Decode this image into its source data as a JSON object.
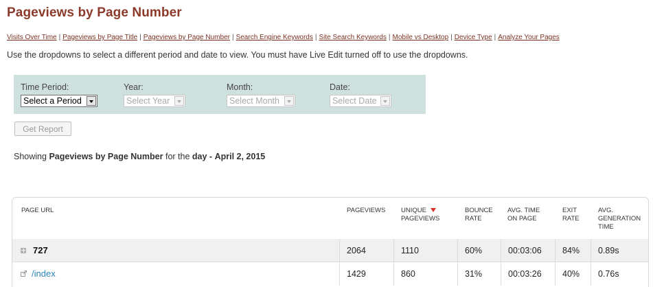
{
  "page": {
    "title": "Pageviews by Page Number",
    "instructions": "Use the dropdowns to select a different period and date to view. You must have Live Edit turned off to use the dropdowns."
  },
  "nav": {
    "links": [
      "Visits Over Time",
      "Pageviews by Page Title",
      "Pageviews by Page Number",
      "Search Engine Keywords",
      "Site Search Keywords",
      "Mobile vs Desktop",
      "Device Type",
      "Analyze Your Pages"
    ],
    "separator": "|"
  },
  "filters": {
    "time_period": {
      "label": "Time Period:",
      "value": "Select a Period"
    },
    "year": {
      "label": "Year:",
      "value": "Select Year"
    },
    "month": {
      "label": "Month:",
      "value": "Select Month"
    },
    "date": {
      "label": "Date:",
      "value": "Select Date"
    },
    "get_report_label": "Get Report"
  },
  "showing": {
    "prefix": "Showing",
    "report_name": "Pageviews by Page Number",
    "middle": "for the",
    "period": "day",
    "dash": "-",
    "date": "April 2, 2015"
  },
  "table": {
    "headers": {
      "page_url": "PAGE URL",
      "pageviews": "PAGEVIEWS",
      "unique_line1": "UNIQUE",
      "unique_line2": "PAGEVIEWS",
      "bounce_line1": "BOUNCE",
      "bounce_line2": "RATE",
      "avgtime_line1": "AVG. TIME",
      "avgtime_line2": "ON PAGE",
      "exit_line1": "EXIT",
      "exit_line2": "RATE",
      "gen_line1": "AVG.",
      "gen_line2": "GENERATION",
      "gen_line3": "TIME"
    },
    "sort_icon": "sort-desc-icon",
    "rows": [
      {
        "page": "727",
        "pageviews": "2064",
        "unique_pageviews": "1110",
        "bounce_rate": "60%",
        "avg_time": "00:03:06",
        "exit_rate": "84%",
        "avg_gen_time": "0.89s"
      },
      {
        "page": "/index",
        "pageviews": "1429",
        "unique_pageviews": "860",
        "bounce_rate": "31%",
        "avg_time": "00:03:26",
        "exit_rate": "40%",
        "avg_gen_time": "0.76s"
      }
    ]
  },
  "colors": {
    "title": "#8b3a2a",
    "nav_link": "#7a3323",
    "filter_panel": "#cfe1df",
    "link": "#2a85b8",
    "sort_arrow": "#d9302a"
  }
}
